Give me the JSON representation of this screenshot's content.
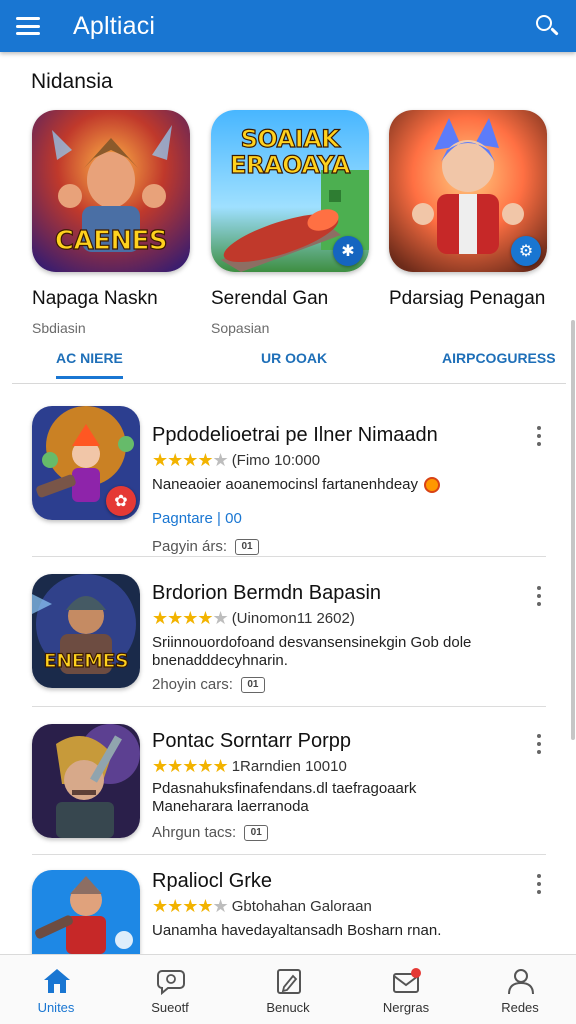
{
  "header": {
    "title": "Apltiaci",
    "menu_icon": "hamburger-menu-icon",
    "search_icon": "search-icon"
  },
  "section": {
    "title": "Nidansia"
  },
  "featured": [
    {
      "name": "Napaga Naskn",
      "sub": "Sbdiasin",
      "art_text": "CAENES",
      "badge_icon": "none"
    },
    {
      "name": "Serendal Gan",
      "sub": "Sopasian",
      "art_text": "SOAIAK ERAOAYA",
      "badge_icon": "puzzle-icon"
    },
    {
      "name": "Pdarsiag Penagan",
      "sub": "",
      "art_text": "",
      "badge_icon": "gear-icon"
    }
  ],
  "tabs": [
    {
      "label": "AC NIERE",
      "active": true
    },
    {
      "label": "UR OOAK",
      "active": false
    },
    {
      "label": "AIRPCOGURESS",
      "active": false
    }
  ],
  "apps": [
    {
      "title": "Ppdodelioetrai pe Ilner Nimaadn",
      "rating_stars": 4,
      "rating_text": "(Fimo 10:000",
      "desc": "Naneaoier aoanemocinsl fartanenhdeay",
      "link": "Pagntare | 00",
      "meta": "Pagyin árs:",
      "meta_chip": "01"
    },
    {
      "title": "Brdorion Bermdn Bapasin",
      "rating_stars": 4,
      "rating_text": "(Uinomon11 2602)",
      "desc": "Sriinnouordofoand desvansensinekgin Gob dole bnenadddecyhnarin.",
      "meta": "2hoyin cars:",
      "meta_chip": "01",
      "art_text": "ENEMES"
    },
    {
      "title": "Pontac Sorntarr Porpp",
      "rating_stars": 5,
      "rating_text": "1Rarndien 10010",
      "desc": "Pdasnahuksfinafendans.dl taefragoaark Maneharara laerranoda",
      "meta": "Ahrgun tacs:",
      "meta_chip": "01"
    },
    {
      "title": "Rpaliocl Grke",
      "rating_stars": 4,
      "rating_text": "Gbtohahan Galoraan",
      "desc": "Uanamha havedayaltansadh Bosharn rnan."
    }
  ],
  "bottom_nav": [
    {
      "label": "Unites",
      "icon": "home-icon",
      "active": true
    },
    {
      "label": "Sueotf",
      "icon": "chat-bubble-icon",
      "active": false
    },
    {
      "label": "Benuck",
      "icon": "edit-icon",
      "active": false
    },
    {
      "label": "Nergras",
      "icon": "mail-notification-icon",
      "active": false
    },
    {
      "label": "Redes",
      "icon": "profile-icon",
      "active": false
    }
  ],
  "colors": {
    "primary": "#1976d2",
    "star": "#f2b300",
    "badge_red": "#e53935"
  }
}
